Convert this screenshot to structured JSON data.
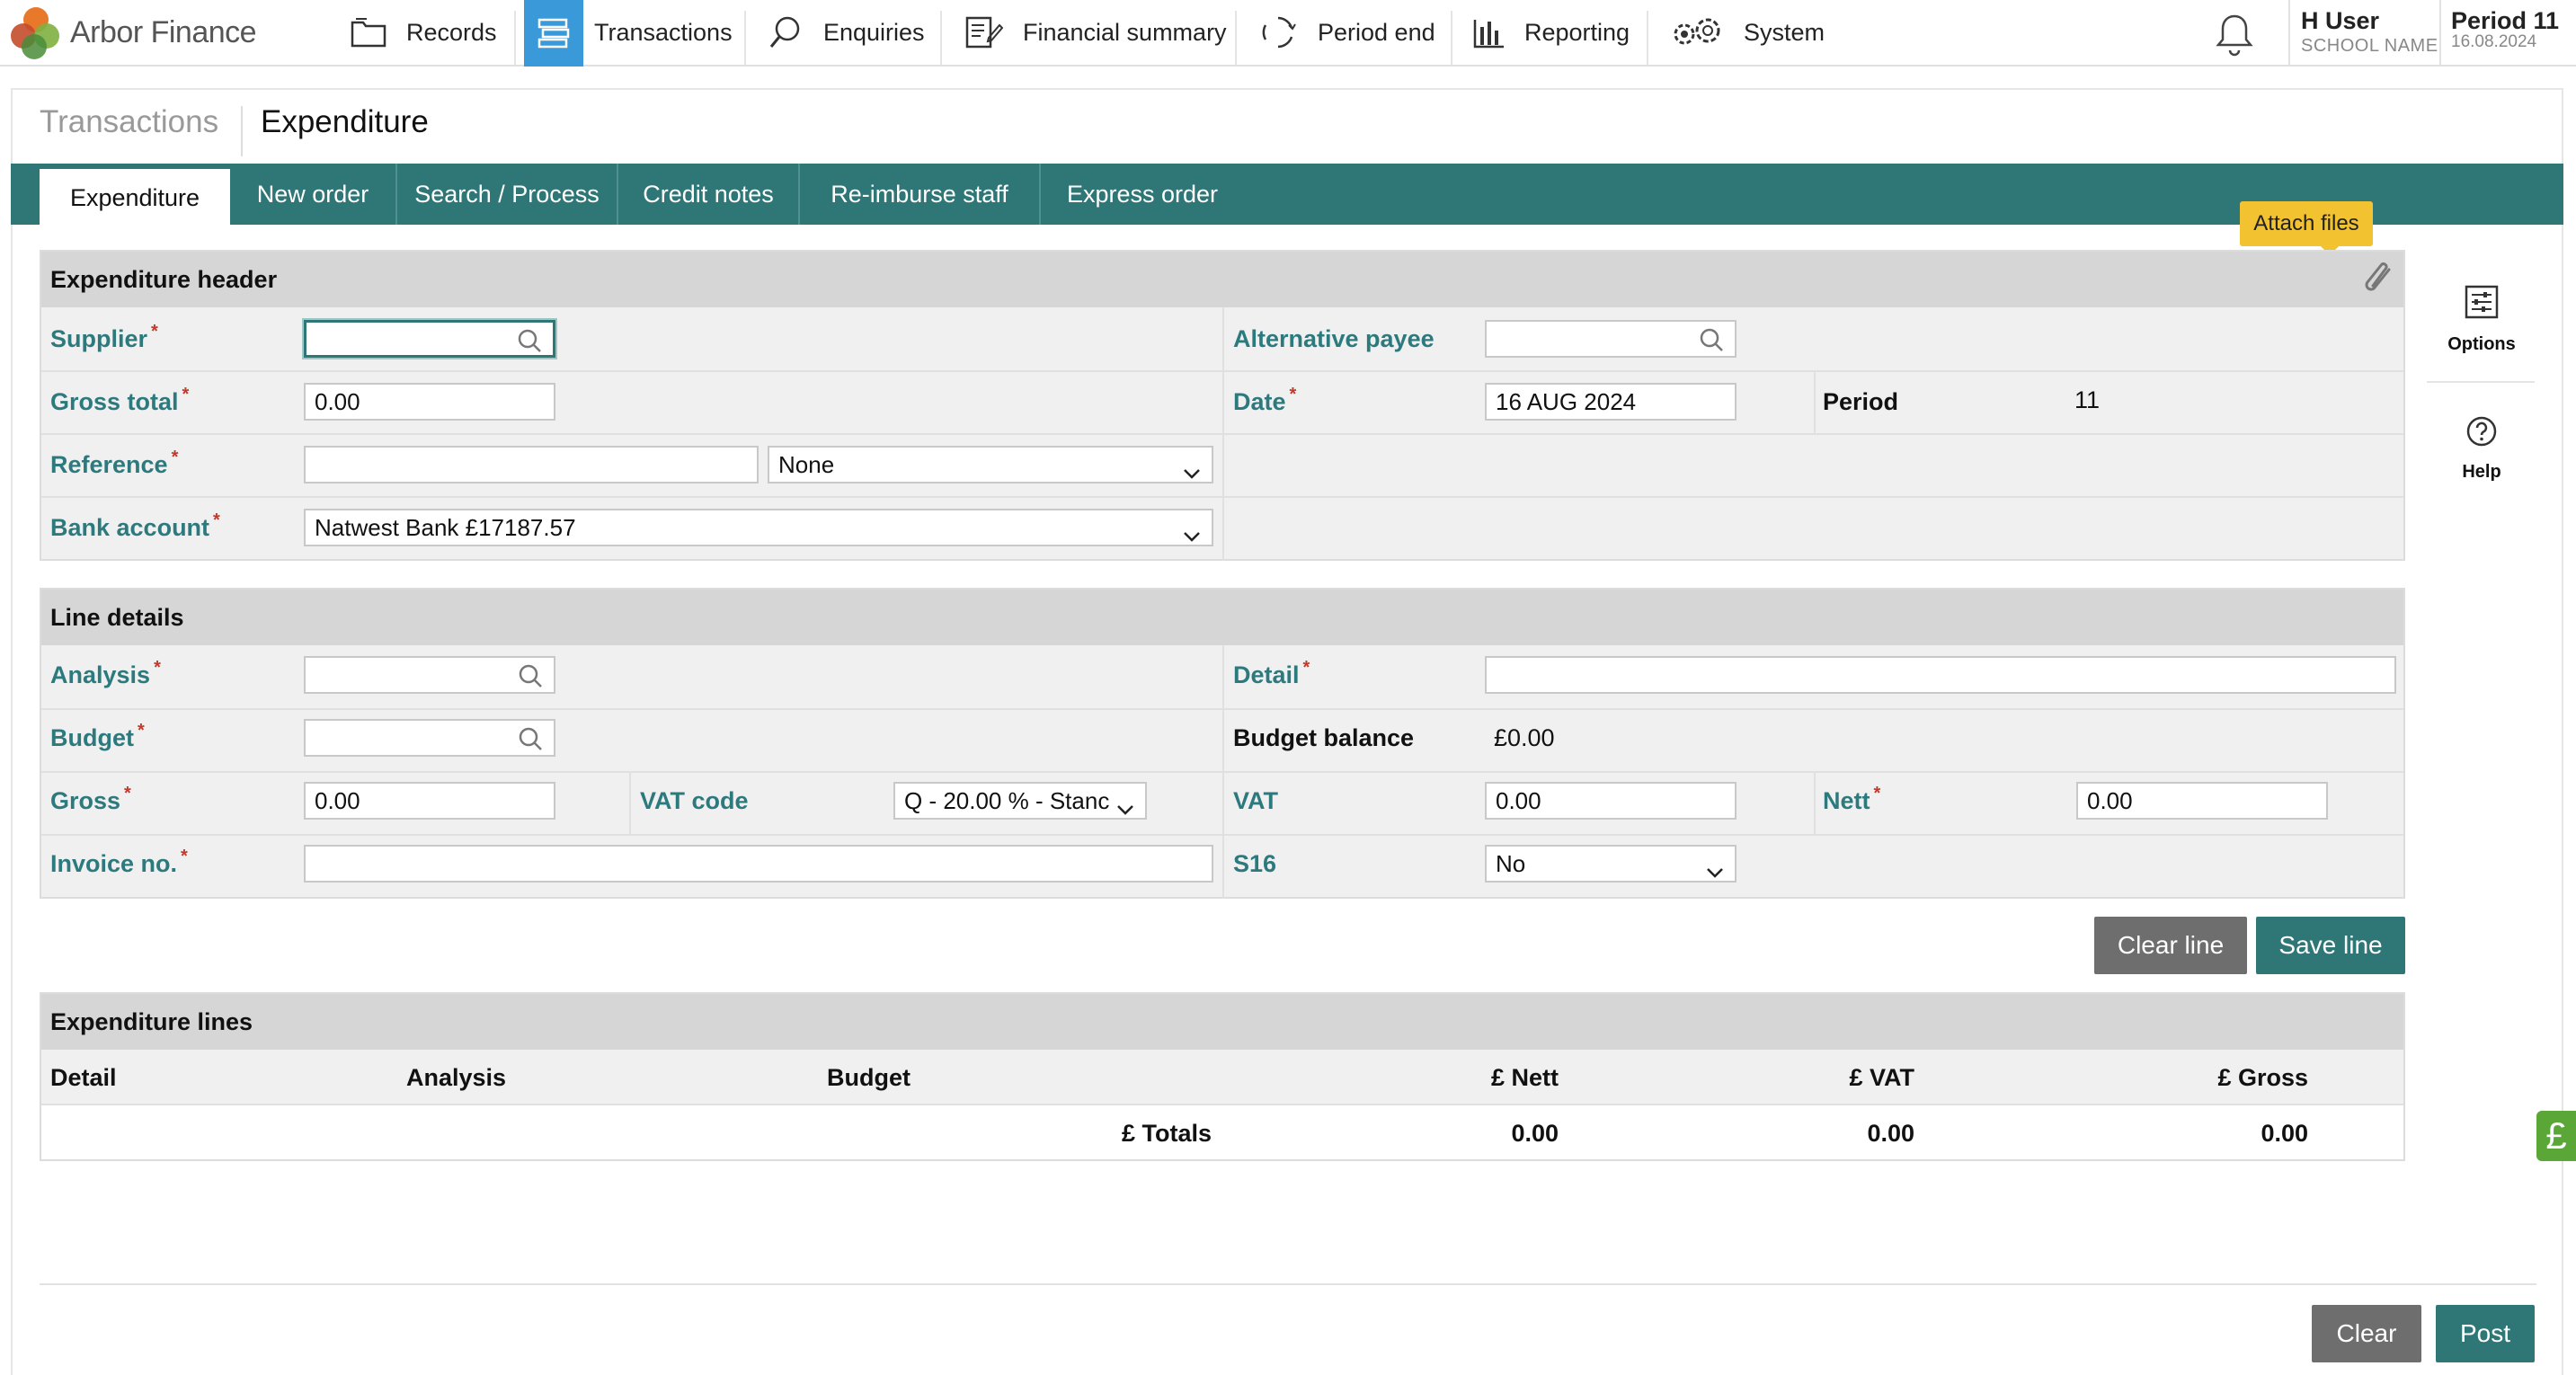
{
  "app": {
    "name": "Arbor Finance",
    "brand_colors": [
      "#e8792b",
      "#7fb040",
      "#2f7776",
      "#c44d2c"
    ]
  },
  "nav": {
    "items": [
      {
        "label": "Records",
        "icon": "folder-icon"
      },
      {
        "label": "Transactions",
        "icon": "transactions-icon",
        "active": true
      },
      {
        "label": "Enquiries",
        "icon": "search-icon"
      },
      {
        "label": "Financial summary",
        "icon": "document-edit-icon"
      },
      {
        "label": "Period end",
        "icon": "refresh-cycle-icon"
      },
      {
        "label": "Reporting",
        "icon": "bar-chart-icon"
      },
      {
        "label": "System",
        "icon": "settings-gears-icon"
      }
    ],
    "notifications_icon": "bell-icon",
    "user": {
      "name": "H User",
      "school": "SCHOOL NAME"
    },
    "period": {
      "label": "Period 11",
      "date": "16.08.2024"
    }
  },
  "breadcrumb": {
    "parent": "Transactions",
    "current": "Expenditure"
  },
  "tabs": [
    {
      "label": "Expenditure",
      "active": true
    },
    {
      "label": "New order"
    },
    {
      "label": "Search / Process"
    },
    {
      "label": "Credit notes"
    },
    {
      "label": "Re-imburse staff"
    },
    {
      "label": "Express order"
    }
  ],
  "tooltip": {
    "attach_files": "Attach files",
    "icon": "paperclip-icon"
  },
  "header_panel": {
    "title": "Expenditure header",
    "supplier": {
      "label": "Supplier",
      "value": ""
    },
    "alt_payee": {
      "label": "Alternative payee",
      "value": ""
    },
    "gross_total": {
      "label": "Gross total",
      "value": "0.00"
    },
    "date": {
      "label": "Date",
      "value": "16 AUG 2024"
    },
    "period": {
      "label": "Period",
      "value": "11"
    },
    "reference": {
      "label": "Reference",
      "value": "",
      "type_selected": "None"
    },
    "bank_account": {
      "label": "Bank account",
      "selected": "Natwest Bank £17187.57"
    }
  },
  "line_panel": {
    "title": "Line details",
    "analysis": {
      "label": "Analysis",
      "value": ""
    },
    "detail": {
      "label": "Detail",
      "value": ""
    },
    "budget": {
      "label": "Budget",
      "value": ""
    },
    "budget_balance": {
      "label": "Budget balance",
      "value": "£0.00"
    },
    "gross": {
      "label": "Gross",
      "value": "0.00"
    },
    "vat_code": {
      "label": "VAT code",
      "selected": "Q - 20.00 % - Stanc"
    },
    "vat": {
      "label": "VAT",
      "value": "0.00"
    },
    "nett": {
      "label": "Nett",
      "value": "0.00"
    },
    "invoice_no": {
      "label": "Invoice no.",
      "value": ""
    },
    "s16": {
      "label": "S16",
      "selected": "No"
    }
  },
  "line_buttons": {
    "clear": "Clear line",
    "save": "Save line"
  },
  "lines_panel": {
    "title": "Expenditure lines",
    "columns": [
      "Detail",
      "Analysis",
      "Budget",
      "£ Nett",
      "£ VAT",
      "£ Gross"
    ],
    "totals": {
      "label": "£ Totals",
      "nett": "0.00",
      "vat": "0.00",
      "gross": "0.00"
    }
  },
  "rail": {
    "options": "Options",
    "help": "Help"
  },
  "pound_tab": "£",
  "footer_buttons": {
    "clear": "Clear",
    "post": "Post"
  }
}
